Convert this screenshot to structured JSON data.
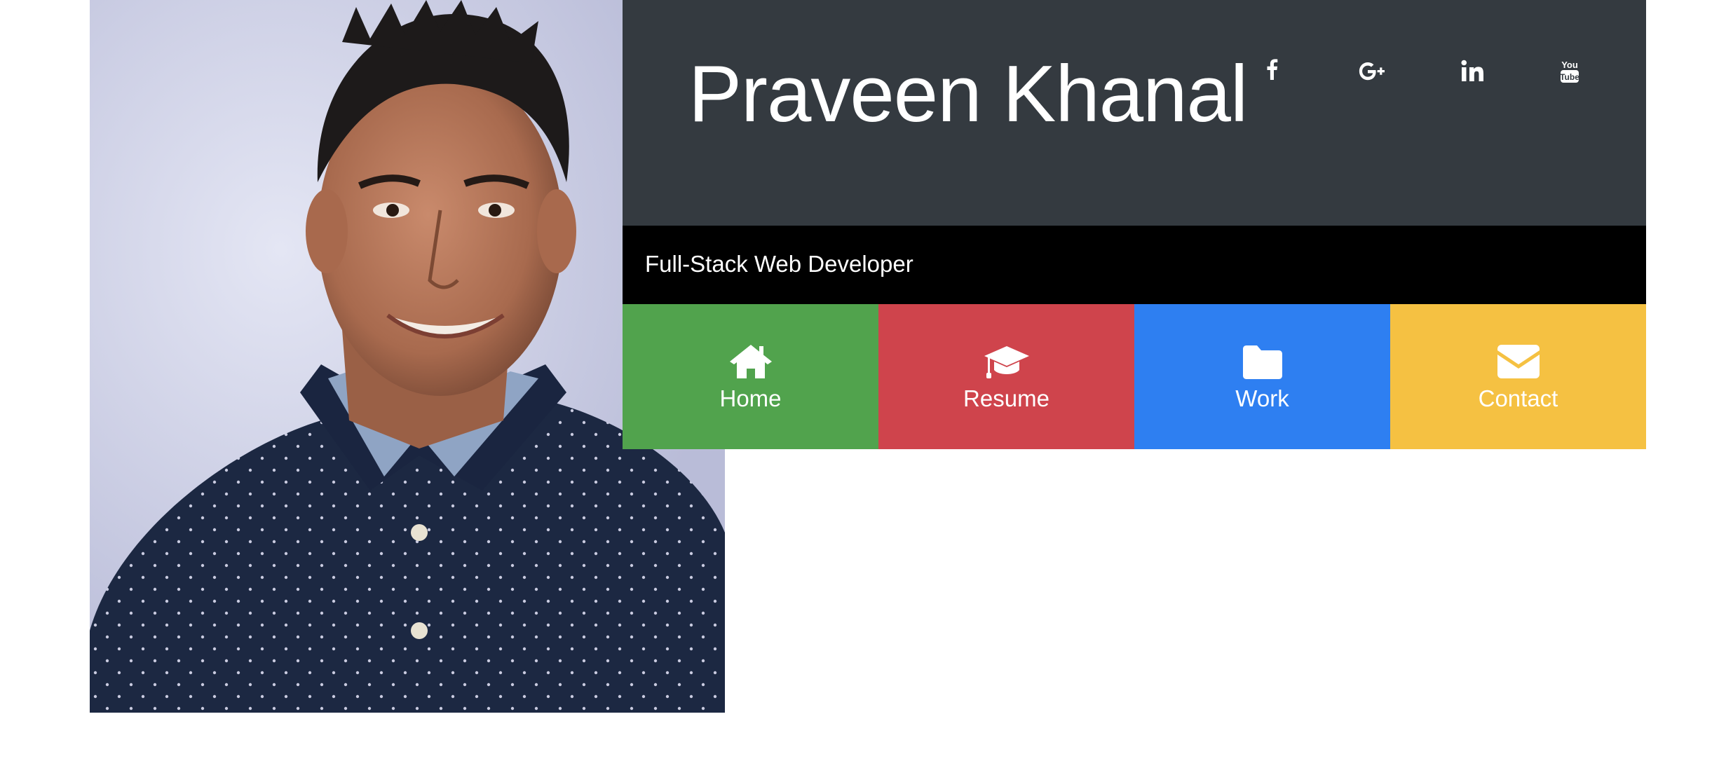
{
  "profile": {
    "name": "Praveen Khanal",
    "tagline": "Full-Stack Web Developer",
    "photo_alt": "Praveen Khanal"
  },
  "social": [
    {
      "label": "f",
      "icon": "facebook-icon"
    },
    {
      "label": "G+",
      "icon": "google-plus-icon"
    },
    {
      "label": "in",
      "icon": "linkedin-icon"
    },
    {
      "label": "You Tube",
      "icon": "youtube-icon"
    }
  ],
  "nav": {
    "items": [
      {
        "label": "Home",
        "icon": "home-icon",
        "color": "#51a34d"
      },
      {
        "label": "Resume",
        "icon": "graduation-cap-icon",
        "color": "#cf444c"
      },
      {
        "label": "Work",
        "icon": "folder-icon",
        "color": "#2e7ff1"
      },
      {
        "label": "Contact",
        "icon": "envelope-icon",
        "color": "#f5c142"
      }
    ]
  },
  "colors": {
    "header_bg": "#343a40",
    "tagline_bg": "#000000",
    "page_bg": "#ffffff"
  }
}
